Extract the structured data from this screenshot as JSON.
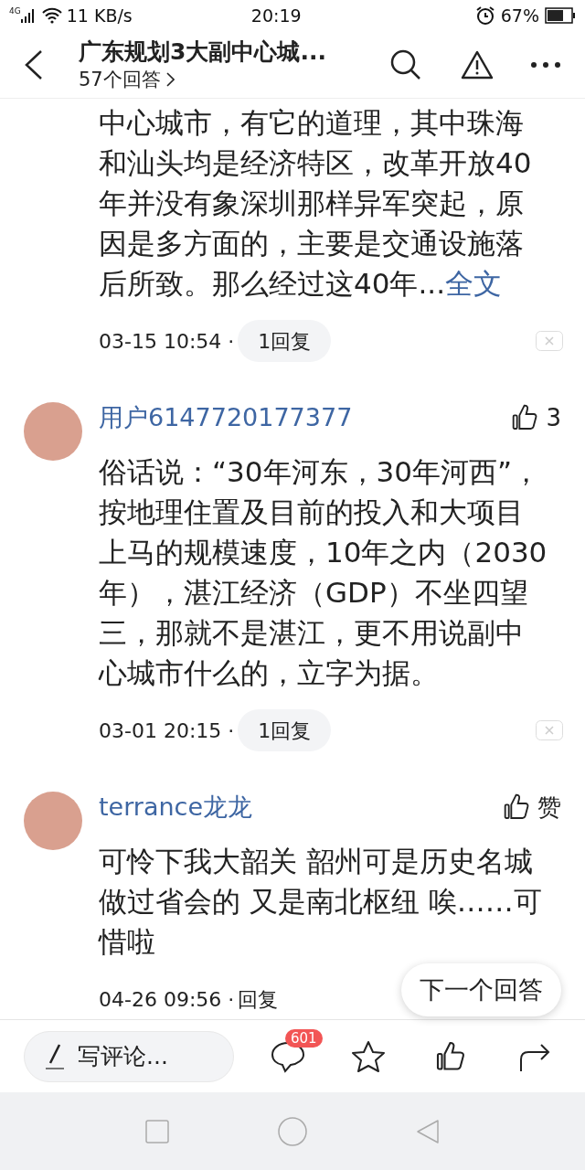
{
  "status_bar": {
    "network": "4G",
    "speed": "11 KB/s",
    "time": "20:19",
    "battery": "67%"
  },
  "header": {
    "title": "广东规划3大副中心城...",
    "subtitle": "57个回答"
  },
  "comments": [
    {
      "text": "中心城市，有它的道理，其中珠海和汕头均是经济特区，改革开放40年并没有象深圳那样异军突起，原因是多方面的，主要是交通设施落后所致。那么经过这40年...",
      "more_link": "全文",
      "time": "03-15 10:54 ·",
      "reply": {
        "label": "1回复",
        "kind": "pill"
      }
    },
    {
      "author": "用户6147720177377",
      "like": "3",
      "text": "俗话说：“30年河东，30年河西”，按地理住置及目前的投入和大项目上马的规模速度，10年之内（2030年），湛江经济（GDP）不坐四望三，那就不是湛江，更不用说副中心城市什么的，立字为据。",
      "time": "03-01 20:15 ·",
      "reply": {
        "label": "1回复",
        "kind": "pill"
      }
    },
    {
      "author": "terrance龙龙",
      "like": "赞",
      "text": "可怜下我大韶关 韶州可是历史名城做过省会的 又是南北枢纽 唉……可惜啦",
      "time": "04-26 09:56 ·",
      "reply": {
        "label": "回复",
        "kind": "plain"
      }
    }
  ],
  "next_button": "下一个回答",
  "bottom_bar": {
    "comment_placeholder": "写评论...",
    "comment_count": "601"
  }
}
